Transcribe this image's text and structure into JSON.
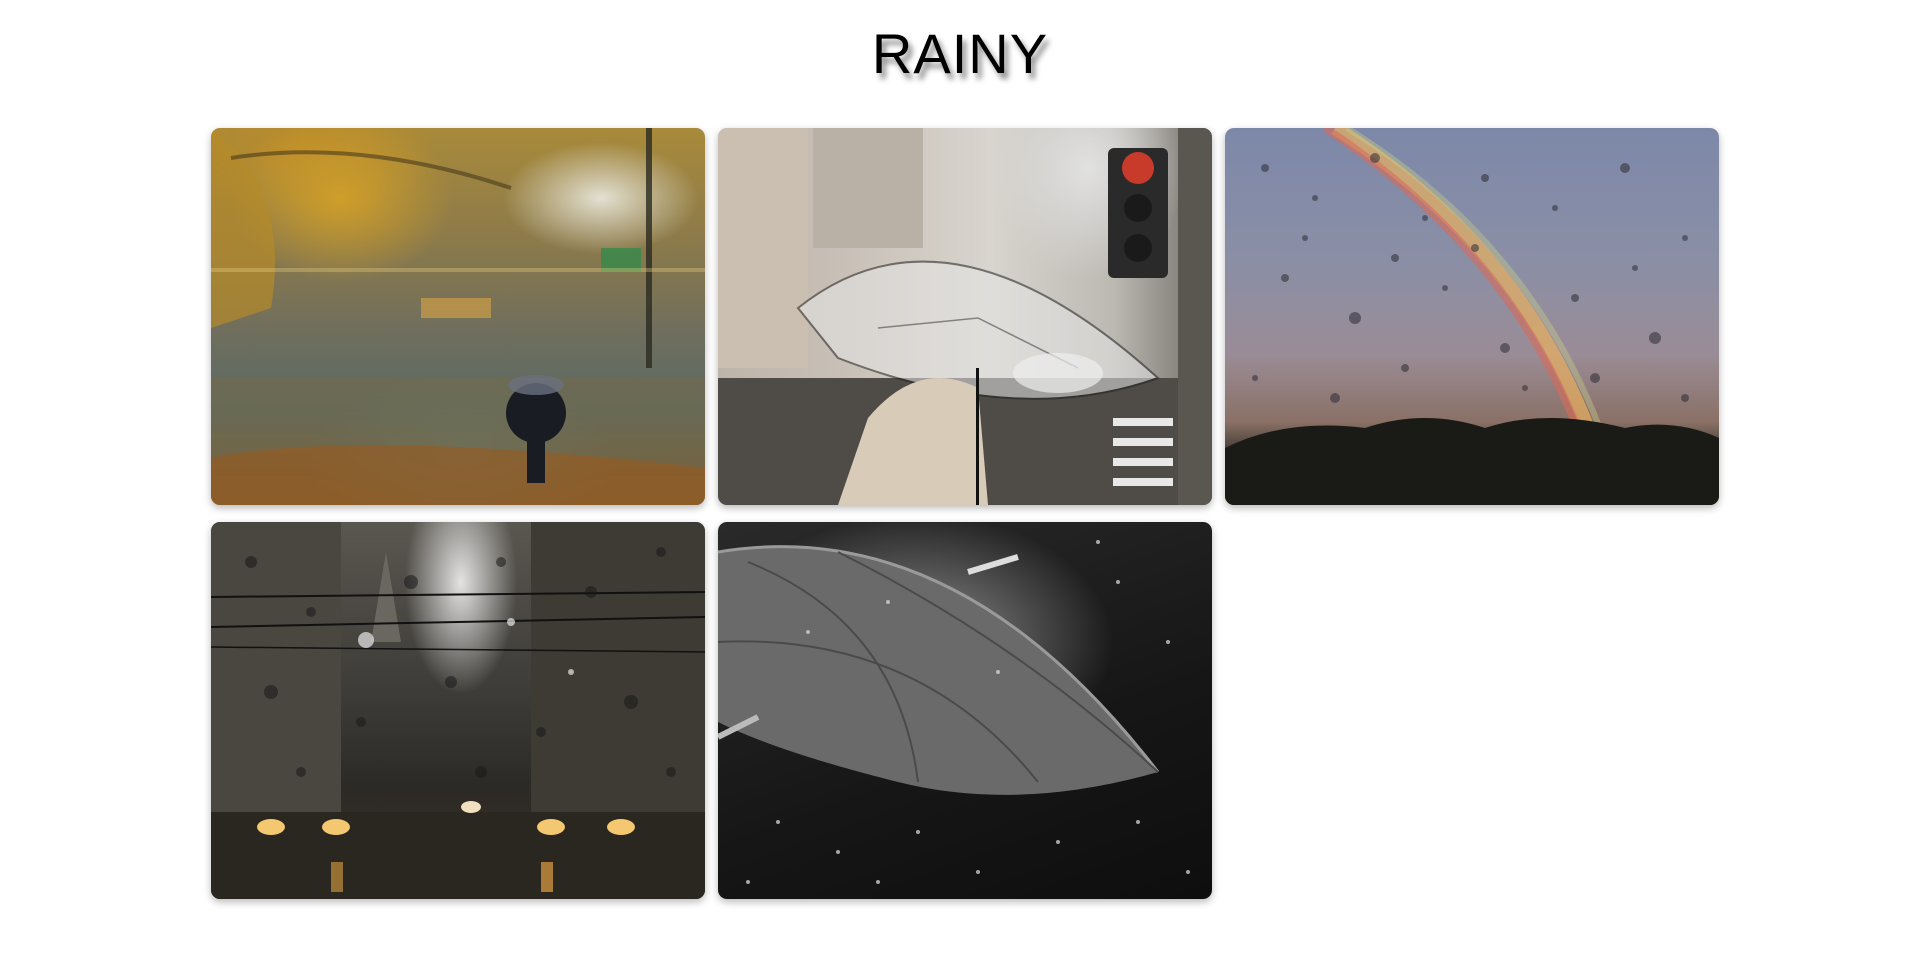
{
  "page": {
    "title": "RAINY"
  },
  "gallery": {
    "items": [
      {
        "name": "autumn-rain-street-photo"
      },
      {
        "name": "transparent-umbrella-street-photo"
      },
      {
        "name": "rainbow-raindrops-window-photo"
      },
      {
        "name": "city-raindrops-window-photo"
      },
      {
        "name": "black-umbrella-rain-photo"
      }
    ]
  }
}
